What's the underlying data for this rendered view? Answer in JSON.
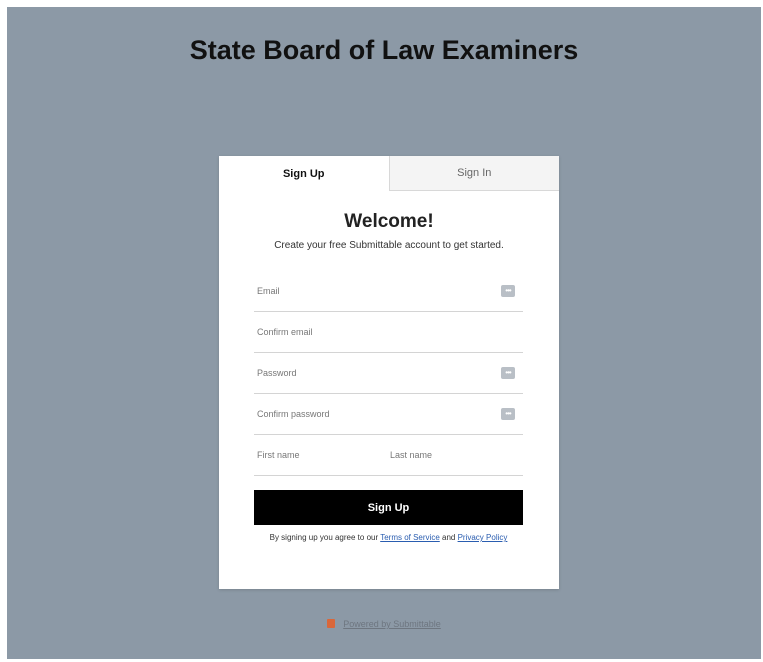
{
  "header": {
    "title": "State Board of Law Examiners"
  },
  "tabs": [
    {
      "label": "Sign Up",
      "active": true
    },
    {
      "label": "Sign In",
      "active": false
    }
  ],
  "card": {
    "welcome": "Welcome!",
    "subtitle": "Create your free Submittable account to get started."
  },
  "form": {
    "email": {
      "placeholder": "Email",
      "value": ""
    },
    "confirm_email": {
      "placeholder": "Confirm email",
      "value": ""
    },
    "password": {
      "placeholder": "Password",
      "value": ""
    },
    "confirm_password": {
      "placeholder": "Confirm password",
      "value": ""
    },
    "first_name": {
      "placeholder": "First name",
      "value": ""
    },
    "last_name": {
      "placeholder": "Last name",
      "value": ""
    },
    "field_icon": "•••",
    "submit_label": "Sign Up"
  },
  "agreement": {
    "prefix": "By signing up you agree to our ",
    "terms_label": "Terms of Service",
    "joiner": " and ",
    "privacy_label": "Privacy Policy"
  },
  "footer": {
    "powered_label": "Powered by Submittable"
  },
  "colors": {
    "background": "#8c99a6",
    "button": "#000000",
    "link": "#2a5db0",
    "logo": "#d9673a"
  }
}
